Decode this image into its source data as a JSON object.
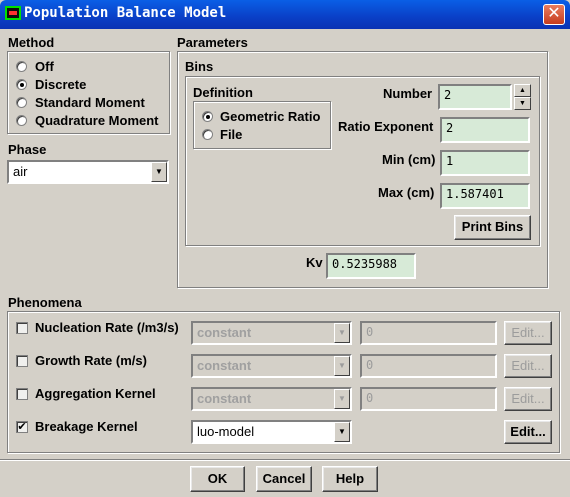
{
  "window": {
    "title": "Population Balance Model",
    "close_glyph": "✕"
  },
  "method": {
    "title": "Method",
    "options": [
      "Off",
      "Discrete",
      "Standard Moment",
      "Quadrature Moment"
    ],
    "selected": "Discrete"
  },
  "phase": {
    "title": "Phase",
    "value": "air"
  },
  "parameters": {
    "title": "Parameters",
    "bins": {
      "title": "Bins",
      "definition": {
        "title": "Definition",
        "options": [
          "Geometric Ratio",
          "File"
        ],
        "selected": "Geometric Ratio"
      },
      "number_label": "Number",
      "number_value": "2",
      "ratio_label": "Ratio Exponent",
      "ratio_value": "2",
      "min_label": "Min (cm)",
      "min_value": "1",
      "max_label": "Max (cm)",
      "max_value": "1.587401",
      "print_bins": "Print Bins"
    },
    "kv_label": "Kv",
    "kv_value": "0.5235988"
  },
  "phenomena": {
    "title": "Phenomena",
    "rows": [
      {
        "label": "Nucleation Rate (/m3/s)",
        "checked": false,
        "method": "constant",
        "value": "0",
        "edit": "Edit...",
        "enabled": false
      },
      {
        "label": "Growth Rate (m/s)",
        "checked": false,
        "method": "constant",
        "value": "0",
        "edit": "Edit...",
        "enabled": false
      },
      {
        "label": "Aggregation Kernel",
        "checked": false,
        "method": "constant",
        "value": "0",
        "edit": "Edit...",
        "enabled": false
      },
      {
        "label": "Breakage Kernel",
        "checked": true,
        "method": "luo-model",
        "value": "",
        "edit": "Edit...",
        "enabled": true
      }
    ]
  },
  "buttons": {
    "ok": "OK",
    "cancel": "Cancel",
    "help": "Help"
  }
}
